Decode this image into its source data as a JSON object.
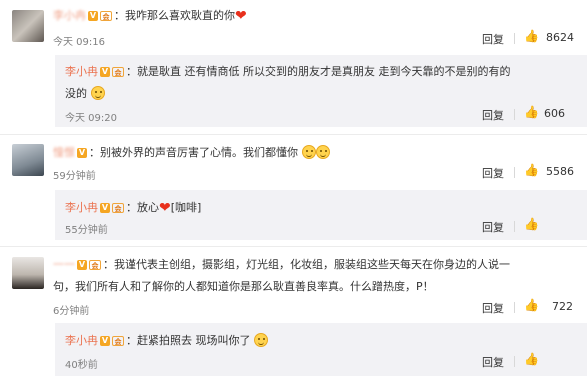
{
  "colors": {
    "username": "#eb7350",
    "reply_bg": "#f2f2f5",
    "heart": "#e8301c",
    "text": "#333333",
    "time": "#808080"
  },
  "actions": {
    "reply": "回复"
  },
  "comments": [
    {
      "user": "李小冉",
      "text_before": "：我咋那么喜欢耿直的你",
      "time": "今天 09:16",
      "likes": "8624",
      "reply": {
        "user": "李小冉",
        "text_line1": "：就是耿直 还有情商低 所以交到的朋友才是真朋友 走到今天靠的不是别的有的",
        "text_line2": "没的",
        "time": "今天 09:20",
        "likes": "606"
      }
    },
    {
      "user": "憧憬",
      "text": "：别被外界的声音厉害了心情。我们都懂你",
      "time": "59分钟前",
      "likes": "5586",
      "reply": {
        "user": "李小冉",
        "text_before": "：放心",
        "text_after": "[咖啡]",
        "time": "55分钟前"
      }
    },
    {
      "user": "一一",
      "text_line1": "：我谨代表主创组，摄影组，灯光组，化妆组，服装组这些天每天在你身边的人说一",
      "text_line2": "句，我们所有人和了解你的人都知道你是那么耿直善良率真。什么蹭热度，P！",
      "time": "6分钟前",
      "likes": "722",
      "reply": {
        "user": "李小冉",
        "text": "：赶紧拍照去 现场叫你了",
        "time": "40秒前"
      }
    }
  ]
}
